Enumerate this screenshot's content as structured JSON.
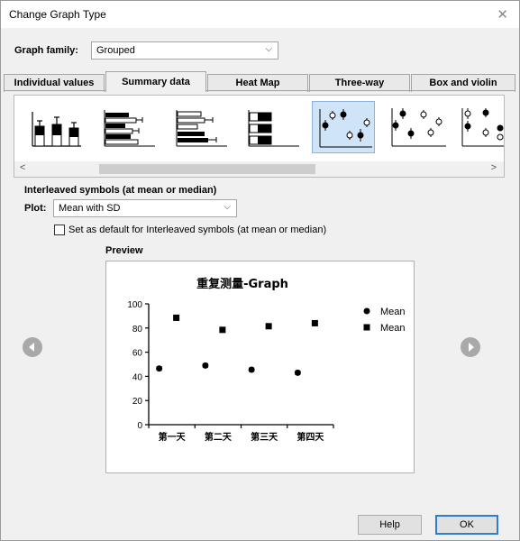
{
  "window": {
    "title": "Change Graph Type",
    "close_icon": "close-icon"
  },
  "graph_family": {
    "label": "Graph family:",
    "value": "Grouped"
  },
  "tabs": [
    {
      "label": "Individual values",
      "active": false
    },
    {
      "label": "Summary data",
      "active": true
    },
    {
      "label": "Heat Map",
      "active": false
    },
    {
      "label": "Three-way",
      "active": false
    },
    {
      "label": "Box and violin",
      "active": false
    }
  ],
  "gallery": {
    "thumbnails": [
      "vertical-bar-error-icon",
      "horizontal-bar-error-icon",
      "horizontal-bar-open-icon",
      "horizontal-stacked-bar-icon",
      "interleaved-symbols-icon",
      "separated-symbols-icon",
      "offset-symbols-icon"
    ],
    "selected_index": 4,
    "scroll_left_icon": "scroll-left-icon",
    "scroll_right_icon": "scroll-right-icon"
  },
  "section_title": "Interleaved symbols (at mean or median)",
  "plot": {
    "label": "Plot:",
    "value": "Mean with SD"
  },
  "default_checkbox": {
    "label": "Set as default for Interleaved symbols (at mean or median)",
    "checked": false
  },
  "preview": {
    "label": "Preview",
    "prev_icon": "previous-arrow-icon",
    "next_icon": "next-arrow-icon"
  },
  "buttons": {
    "help": "Help",
    "ok": "OK"
  },
  "colors": {
    "selection": "#cfe4f7",
    "ok_border": "#2d7fd4",
    "nav": "#a9a9a9"
  },
  "chart_data": {
    "type": "scatter",
    "title": "重复测量-Graph",
    "categories": [
      "第一天",
      "第二天",
      "第三天",
      "第四天"
    ],
    "series": [
      {
        "name": "Mean",
        "marker": "circle",
        "values": [
          46.5,
          49,
          45.5,
          43
        ],
        "sd": [
          1.5,
          1.5,
          1.5,
          1.5
        ]
      },
      {
        "name": "Mean",
        "marker": "square",
        "values": [
          88.5,
          78.5,
          81.5,
          84
        ],
        "sd": [
          2,
          1.5,
          1.5,
          1.5
        ]
      }
    ],
    "ylim": [
      0,
      100
    ],
    "yticks": [
      "0",
      "20",
      "40",
      "60",
      "80",
      "100"
    ],
    "legend": "top-right",
    "grid": false
  }
}
